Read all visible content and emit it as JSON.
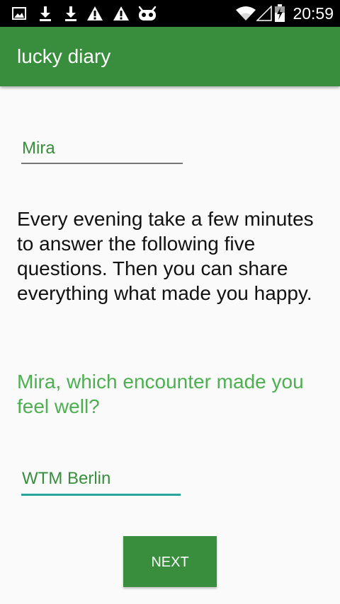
{
  "status_bar": {
    "time": "20:59",
    "notification_icons": [
      "image-icon",
      "download-icon",
      "download-icon",
      "warning-icon",
      "warning-icon",
      "android-bot-icon"
    ],
    "system_icons": [
      "wifi-icon",
      "signal-icon",
      "battery-icon"
    ]
  },
  "app_bar": {
    "title": "lucky diary"
  },
  "form": {
    "name_value": "Mira",
    "intro_text": "Every evening take a few minutes to answer the following five questions. Then you can share everything what made you happy.",
    "question_text": "Mira, which encounter made you feel well?",
    "answer_value": "WTM Berlin",
    "next_label": "NEXT"
  },
  "colors": {
    "primary": "#388e3c",
    "accent_text": "#4caf50",
    "input_focus": "#26a69a",
    "background": "#fafafa"
  }
}
